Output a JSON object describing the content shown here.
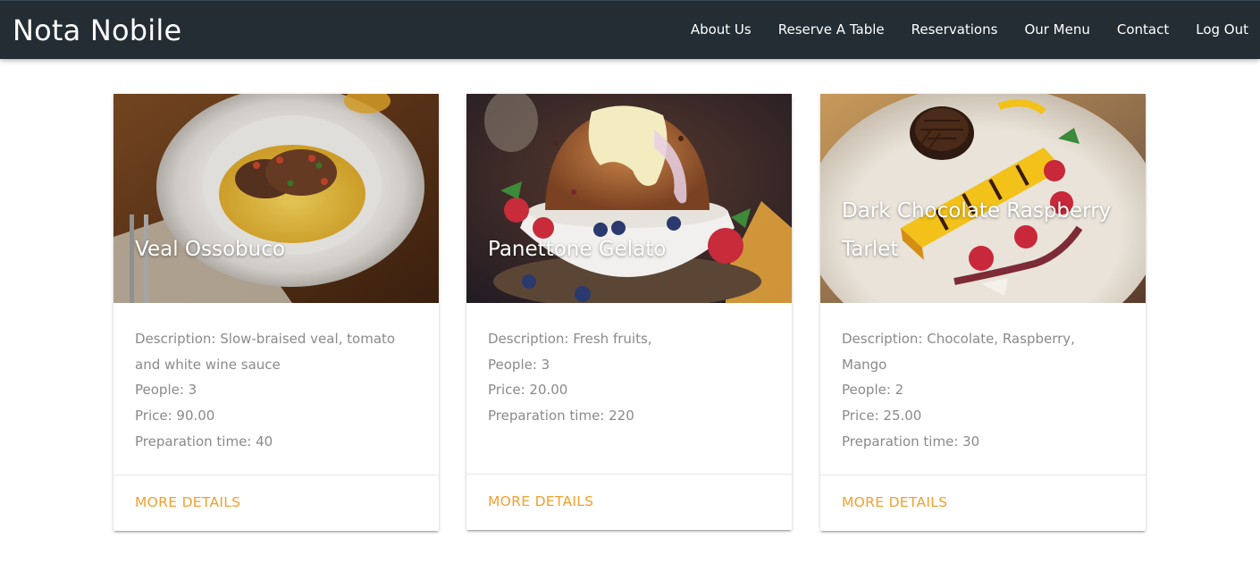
{
  "navbar": {
    "brand": "Nota Nobile",
    "links": [
      "About Us",
      "Reserve A Table",
      "Reservations",
      "Our Menu",
      "Contact",
      "Log Out"
    ],
    "background": "#232d33"
  },
  "cards": [
    {
      "title": "Veal Ossobuco",
      "description": "Description: Slow-braised veal, tomato and white wine sauce",
      "people": "People: 3",
      "price": "Price: 90.00",
      "prep_time": "Preparation time: 40",
      "action": "MORE DETAILS"
    },
    {
      "title": "Panettone Gelato",
      "description": "Description: Fresh fruits,",
      "people": "People: 3",
      "price": "Price: 20.00",
      "prep_time": "Preparation time: 220",
      "action": "MORE DETAILS"
    },
    {
      "title": "Dark Chocolate Raspberry Tarlet",
      "description": "Description: Chocolate, Raspberry, Mango",
      "people": "People: 2",
      "price": "Price: 25.00",
      "prep_time": "Preparation time: 30",
      "action": "MORE DETAILS"
    }
  ],
  "colors": {
    "accent": "#f0a030",
    "body_text": "#8a8a8a"
  }
}
